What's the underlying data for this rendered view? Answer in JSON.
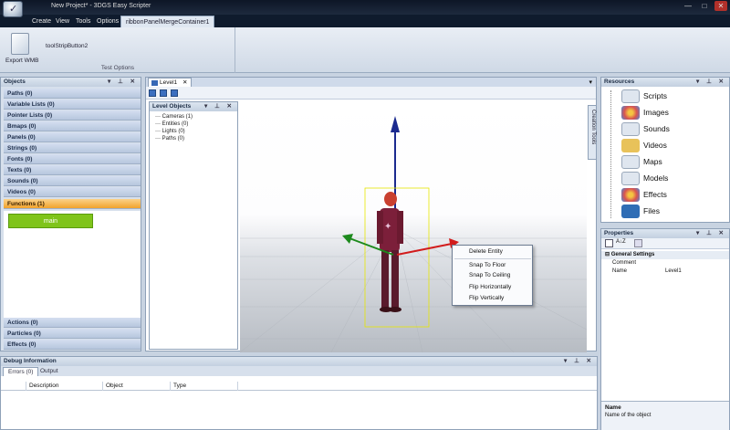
{
  "window": {
    "title": "New Project* - 3DGS Easy Scripter",
    "controls": {
      "minimize": "—",
      "maximize": "□",
      "close": "✕"
    }
  },
  "menu": {
    "tabs": [
      "Create",
      "View",
      "Tools",
      "Options",
      "ribbonPanelMergeContainer1"
    ]
  },
  "ribbon": {
    "export_label": "Export WMB",
    "toolstrip_label": "toolStripButton2",
    "group_caption": "Test Options"
  },
  "objects_panel": {
    "title": "Objects",
    "header_buttons": "▾ ⊥ ✕",
    "items_top": [
      "Paths (0)",
      "Variable Lists (0)",
      "Pointer Lists (0)",
      "Bmaps (0)",
      "Panels (0)",
      "Strings (0)",
      "Fonts (0)",
      "Texts (0)",
      "Sounds (0)",
      "Videos (0)",
      "Functions (1)"
    ],
    "function_entry": "main",
    "items_bottom": [
      "Actions (0)",
      "Particles (0)",
      "Effects (0)"
    ]
  },
  "document": {
    "tab_label": "Level1",
    "tab_close": "✕",
    "dropdown": "▾"
  },
  "level_objects": {
    "title": "Level Objects",
    "header_buttons": "▾ ⊥ ✕",
    "items": [
      "Cameras (1)",
      "Entities (0)",
      "Lights (0)",
      "Paths (0)"
    ]
  },
  "side_tab": {
    "label": "Creation Tools"
  },
  "context_menu": {
    "items": [
      "Delete Entity",
      "Snap To Floor",
      "Snap To Ceiling",
      "Flip Horizontally",
      "Flip Vertically"
    ]
  },
  "resources": {
    "title": "Resources",
    "header_buttons": "▾ ⊥ ✕",
    "items": [
      {
        "label": "Scripts",
        "icon": "scripts-icon",
        "color": "#dfe6ef"
      },
      {
        "label": "Images",
        "icon": "images-icon",
        "color": "#d9534f"
      },
      {
        "label": "Sounds",
        "icon": "sounds-icon",
        "color": "#dfe6ef"
      },
      {
        "label": "Videos",
        "icon": "videos-icon",
        "color": "#e8c25a"
      },
      {
        "label": "Maps",
        "icon": "maps-icon",
        "color": "#dfe6ef"
      },
      {
        "label": "Models",
        "icon": "models-icon",
        "color": "#dfe6ef"
      },
      {
        "label": "Effects",
        "icon": "effects-icon",
        "color": "#d9534f"
      },
      {
        "label": "Files",
        "icon": "files-icon",
        "color": "#2f6db5"
      }
    ]
  },
  "properties": {
    "title": "Properties",
    "header_buttons": "▾ ⊥ ✕",
    "sort_label": "A↓Z",
    "category": "General Settings",
    "rows": [
      {
        "name": "Comment",
        "value": ""
      },
      {
        "name": "Name",
        "value": "Level1"
      }
    ],
    "desc_title": "Name",
    "desc_text": "Name of the object"
  },
  "debug": {
    "title": "Debug Information",
    "header_buttons": "▾ ⊥ ✕",
    "tabs": [
      "Errors (0)",
      "Output"
    ],
    "columns": [
      "Description",
      "Object",
      "Type"
    ]
  }
}
